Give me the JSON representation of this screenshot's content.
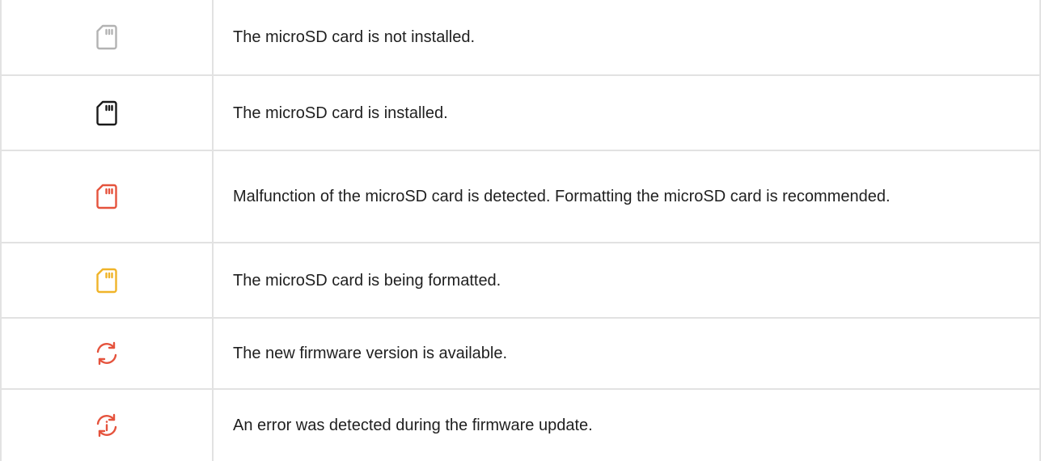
{
  "rows": [
    {
      "icon": "sd-card-icon",
      "icon_state": "not-installed",
      "icon_color": "#b3b3b3",
      "text": "The microSD card is not installed."
    },
    {
      "icon": "sd-card-icon",
      "icon_state": "installed",
      "icon_color": "#1a1a1a",
      "text": "The microSD card is installed."
    },
    {
      "icon": "sd-card-icon",
      "icon_state": "malfunction",
      "icon_color": "#e5533d",
      "text": "Malfunction of the microSD card is detected. Formatting the microSD card is recommended."
    },
    {
      "icon": "sd-card-icon",
      "icon_state": "formatting",
      "icon_color": "#f0b429",
      "text": "The microSD card is being formatted."
    },
    {
      "icon": "firmware-update-icon",
      "icon_state": "update-available",
      "icon_color": "#e5533d",
      "text": "The new firmware version is available."
    },
    {
      "icon": "firmware-error-icon",
      "icon_state": "update-error",
      "icon_color": "#e5533d",
      "text": "An error was detected during the firmware update."
    }
  ]
}
